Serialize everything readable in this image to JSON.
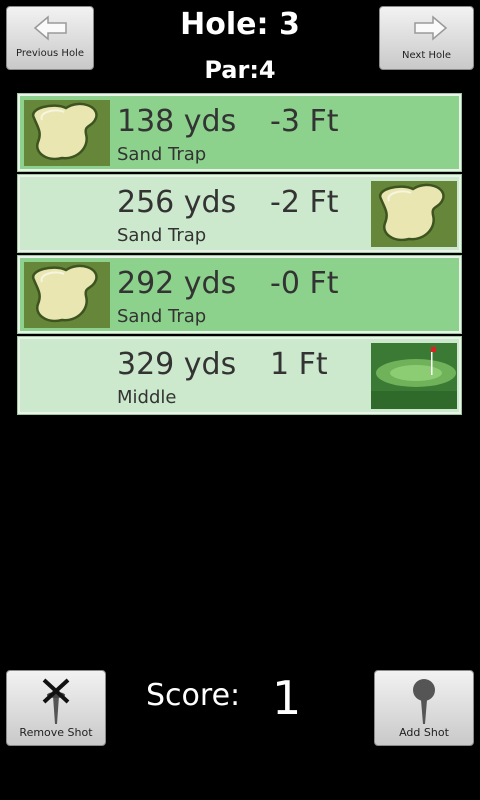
{
  "header": {
    "hole_title": "Hole: 3",
    "par_title": "Par:4",
    "prev_label": "Previous Hole",
    "next_label": "Next Hole",
    "prev_icon": "arrow-left-icon",
    "next_icon": "arrow-right-icon"
  },
  "shots": [
    {
      "distance": "138 yds",
      "offset": "-3 Ft",
      "lie": "Sand Trap",
      "image": "sand-trap-icon",
      "image_side": "left",
      "shade": "dark"
    },
    {
      "distance": "256 yds",
      "offset": "-2 Ft",
      "lie": "Sand Trap",
      "image": "sand-trap-icon",
      "image_side": "right",
      "shade": "light"
    },
    {
      "distance": "292 yds",
      "offset": "-0 Ft",
      "lie": "Sand Trap",
      "image": "sand-trap-icon",
      "image_side": "left",
      "shade": "dark"
    },
    {
      "distance": "329 yds",
      "offset": "1 Ft",
      "lie": "Middle",
      "image": "fairway-green-icon",
      "image_side": "right",
      "shade": "light"
    }
  ],
  "footer": {
    "remove_label": "Remove Shot",
    "add_label": "Add Shot",
    "score_label": "Score:",
    "score_value": "1",
    "remove_icon": "golf-tee-x-icon",
    "add_icon": "golf-tee-ball-icon"
  },
  "colors": {
    "row_dark": "#8cd18c",
    "row_light": "#cde9cd",
    "background": "#000000"
  }
}
